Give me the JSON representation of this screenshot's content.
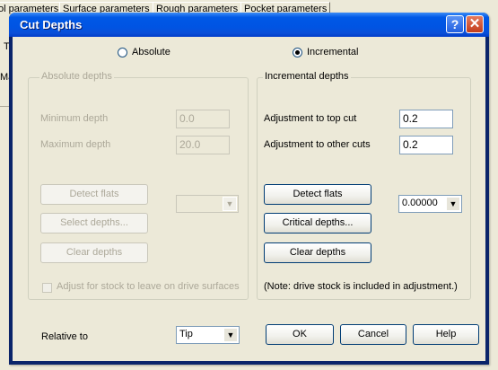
{
  "background": {
    "tabs": [
      "ol parameters",
      "Surface parameters",
      "Rough parameters",
      "Pocket parameters"
    ],
    "side_labels": [
      "To",
      "Ma"
    ]
  },
  "dialog": {
    "title": "Cut Depths",
    "help_glyph": "?",
    "close_glyph": "✕",
    "mode": {
      "absolute_label": "Absolute",
      "incremental_label": "Incremental",
      "selected": "Incremental"
    },
    "absolute_group": {
      "title": "Absolute depths",
      "min_label": "Minimum depth",
      "min_value": "0.0",
      "max_label": "Maximum depth",
      "max_value": "20.0",
      "detect_flats": "Detect flats",
      "select_depths": "Select depths...",
      "clear_depths": "Clear depths",
      "adjust_stock_label": "Adjust for stock to leave on drive surfaces"
    },
    "incremental_group": {
      "title": "Incremental depths",
      "top_cut_label": "Adjustment to top cut",
      "top_cut_value": "0.2",
      "other_cuts_label": "Adjustment to other cuts",
      "other_cuts_value": "0.2",
      "detect_flats": "Detect flats",
      "critical_depths": "Critical depths...",
      "clear_depths": "Clear depths",
      "tolerance_value": "0.00000",
      "note": "(Note:  drive stock is included in adjustment.)"
    },
    "relative_to": {
      "label": "Relative to",
      "value": "Tip"
    },
    "buttons": {
      "ok": "OK",
      "cancel": "Cancel",
      "help": "Help"
    },
    "dropdown_arrow": "▼"
  }
}
